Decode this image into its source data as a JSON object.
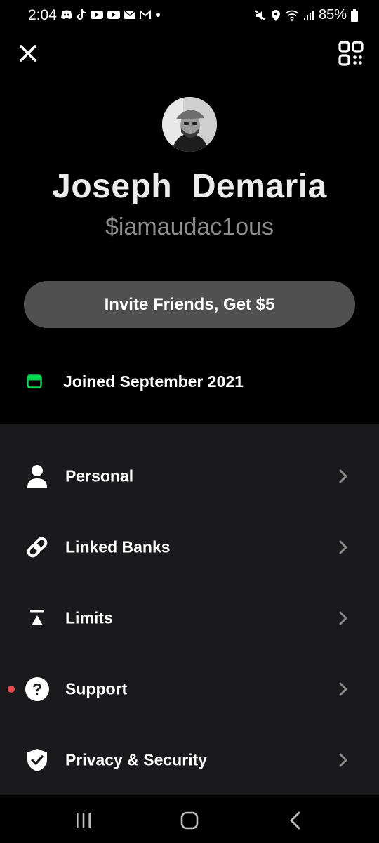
{
  "status_bar": {
    "time": "2:04",
    "battery": "85%",
    "notification_icons": [
      "discord-icon",
      "tiktok-icon",
      "youtube-icon",
      "youtube-icon",
      "mail-icon",
      "gmail-icon",
      "dot-icon"
    ],
    "system_icons": [
      "mute-icon",
      "location-icon",
      "wifi-icon",
      "signal-icon",
      "battery-icon"
    ]
  },
  "header": {
    "close_icon": "close-icon",
    "qr_icon": "qr-code-icon"
  },
  "profile": {
    "name": "Joseph  Demaria",
    "handle": "$iamaudac1ous"
  },
  "invite_button": {
    "label": "Invite Friends, Get $5"
  },
  "joined": {
    "text": "Joined September 2021",
    "accent_color": "#00d64f"
  },
  "menu": {
    "items": [
      {
        "label": "Personal",
        "icon": "person-icon"
      },
      {
        "label": "Linked Banks",
        "icon": "link-icon"
      },
      {
        "label": "Limits",
        "icon": "limits-icon"
      },
      {
        "label": "Support",
        "icon": "help-icon",
        "badge": "red-dot"
      },
      {
        "label": "Privacy & Security",
        "icon": "shield-check-icon"
      }
    ]
  },
  "nav_bar": {
    "buttons": [
      "recents-icon",
      "home-icon",
      "back-icon"
    ]
  },
  "colors": {
    "background": "#000000",
    "menu_background": "#1a1a1c",
    "invite_button": "#505050",
    "handle_text": "#8c8c8c",
    "notification_dot": "#e5484d"
  }
}
